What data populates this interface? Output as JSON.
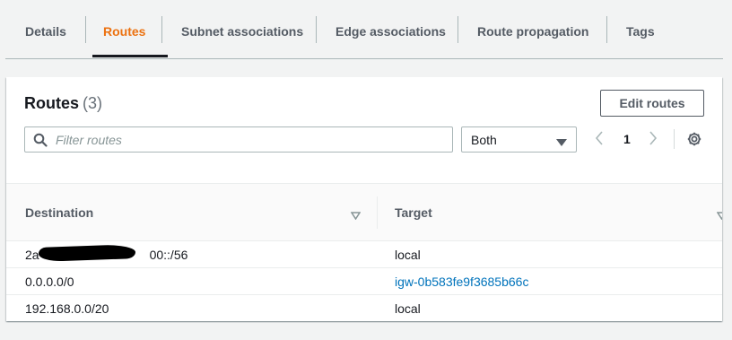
{
  "tabs": [
    {
      "label": "Details",
      "active": false
    },
    {
      "label": "Routes",
      "active": true
    },
    {
      "label": "Subnet associations",
      "active": false
    },
    {
      "label": "Edge associations",
      "active": false
    },
    {
      "label": "Route propagation",
      "active": false
    },
    {
      "label": "Tags",
      "active": false
    }
  ],
  "routes": {
    "title": "Routes",
    "count": "(3)",
    "edit_button": "Edit routes",
    "filter_placeholder": "Filter routes",
    "filter_select": "Both",
    "page": "1",
    "columns": [
      "Destination",
      "Target"
    ],
    "rows": [
      {
        "destination": "2a",
        "destination_suffix": "00::/56",
        "redacted": true,
        "target": "local",
        "target_link": false
      },
      {
        "destination": "0.0.0.0/0",
        "target": "igw-0b583fe9f3685b66c",
        "target_link": true
      },
      {
        "destination": "192.168.0.0/20",
        "target": "local",
        "target_link": false
      }
    ]
  },
  "colors": {
    "accent": "#ec7211",
    "link": "#0073bb"
  },
  "icons": [
    "search-icon",
    "caret-down-icon",
    "chevron-left-icon",
    "chevron-right-icon",
    "gear-icon",
    "sort-icon"
  ]
}
